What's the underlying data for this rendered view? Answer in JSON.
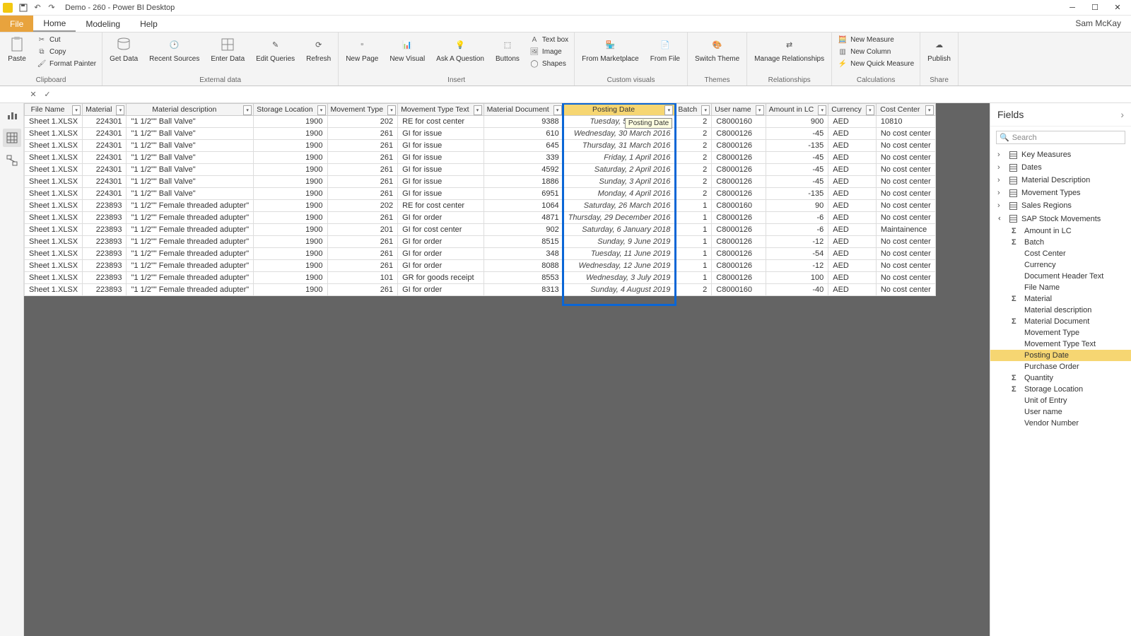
{
  "title": "Demo - 260 - Power BI Desktop",
  "user": "Sam McKay",
  "menu": {
    "file": "File",
    "tabs": [
      "Home",
      "Modeling",
      "Help"
    ],
    "active": "Home"
  },
  "ribbon": {
    "clipboard": {
      "title": "Clipboard",
      "paste": "Paste",
      "cut": "Cut",
      "copy": "Copy",
      "fmt": "Format Painter"
    },
    "external": {
      "title": "External data",
      "get": "Get\nData",
      "recent": "Recent\nSources",
      "enter": "Enter\nData",
      "edit": "Edit\nQueries",
      "refresh": "Refresh"
    },
    "insert": {
      "title": "Insert",
      "page": "New\nPage",
      "visual": "New\nVisual",
      "ask": "Ask A\nQuestion",
      "buttons": "Buttons",
      "text": "Text box",
      "image": "Image",
      "shapes": "Shapes"
    },
    "custom": {
      "title": "Custom visuals",
      "market": "From\nMarketplace",
      "file": "From\nFile"
    },
    "themes": {
      "title": "Themes",
      "switch": "Switch\nTheme"
    },
    "rel": {
      "title": "Relationships",
      "manage": "Manage\nRelationships"
    },
    "calc": {
      "title": "Calculations",
      "nm": "New Measure",
      "nc": "New Column",
      "nq": "New Quick Measure"
    },
    "share": {
      "title": "Share",
      "publish": "Publish"
    }
  },
  "columns": [
    "File Name",
    "Material",
    "Material description",
    "Storage Location",
    "Movement Type",
    "Movement Type Text",
    "Material Document",
    "Posting Date",
    "Batch",
    "User name",
    "Amount in LC",
    "Currency",
    "Cost Center"
  ],
  "highlightCol": 7,
  "tooltip": "Posting Date",
  "rows": [
    [
      "Sheet 1.XLSX",
      "224301",
      "\"1 1/2\"\" Ball Valve\"",
      "1900",
      "202",
      "RE for cost center",
      "9388",
      "Tuesday, 5 March 2016",
      "2",
      "C8000160",
      "900",
      "AED",
      "10810"
    ],
    [
      "Sheet 1.XLSX",
      "224301",
      "\"1 1/2\"\" Ball Valve\"",
      "1900",
      "261",
      "GI for issue",
      "610",
      "Wednesday, 30 March 2016",
      "2",
      "C8000126",
      "-45",
      "AED",
      "No cost center"
    ],
    [
      "Sheet 1.XLSX",
      "224301",
      "\"1 1/2\"\" Ball Valve\"",
      "1900",
      "261",
      "GI for issue",
      "645",
      "Thursday, 31 March 2016",
      "2",
      "C8000126",
      "-135",
      "AED",
      "No cost center"
    ],
    [
      "Sheet 1.XLSX",
      "224301",
      "\"1 1/2\"\" Ball Valve\"",
      "1900",
      "261",
      "GI for issue",
      "339",
      "Friday, 1 April 2016",
      "2",
      "C8000126",
      "-45",
      "AED",
      "No cost center"
    ],
    [
      "Sheet 1.XLSX",
      "224301",
      "\"1 1/2\"\" Ball Valve\"",
      "1900",
      "261",
      "GI for issue",
      "4592",
      "Saturday, 2 April 2016",
      "2",
      "C8000126",
      "-45",
      "AED",
      "No cost center"
    ],
    [
      "Sheet 1.XLSX",
      "224301",
      "\"1 1/2\"\" Ball Valve\"",
      "1900",
      "261",
      "GI for issue",
      "1886",
      "Sunday, 3 April 2016",
      "2",
      "C8000126",
      "-45",
      "AED",
      "No cost center"
    ],
    [
      "Sheet 1.XLSX",
      "224301",
      "\"1 1/2\"\" Ball Valve\"",
      "1900",
      "261",
      "GI for issue",
      "6951",
      "Monday, 4 April 2016",
      "2",
      "C8000126",
      "-135",
      "AED",
      "No cost center"
    ],
    [
      "Sheet 1.XLSX",
      "223893",
      "\"1 1/2\"\" Female threaded adupter\"",
      "1900",
      "202",
      "RE for cost center",
      "1064",
      "Saturday, 26 March 2016",
      "1",
      "C8000160",
      "90",
      "AED",
      "No cost center"
    ],
    [
      "Sheet 1.XLSX",
      "223893",
      "\"1 1/2\"\" Female threaded adupter\"",
      "1900",
      "261",
      "GI for order",
      "4871",
      "Thursday, 29 December 2016",
      "1",
      "C8000126",
      "-6",
      "AED",
      "No cost center"
    ],
    [
      "Sheet 1.XLSX",
      "223893",
      "\"1 1/2\"\" Female threaded adupter\"",
      "1900",
      "201",
      "GI for cost center",
      "902",
      "Saturday, 6 January 2018",
      "1",
      "C8000126",
      "-6",
      "AED",
      "Maintainence"
    ],
    [
      "Sheet 1.XLSX",
      "223893",
      "\"1 1/2\"\" Female threaded adupter\"",
      "1900",
      "261",
      "GI for order",
      "8515",
      "Sunday, 9 June 2019",
      "1",
      "C8000126",
      "-12",
      "AED",
      "No cost center"
    ],
    [
      "Sheet 1.XLSX",
      "223893",
      "\"1 1/2\"\" Female threaded adupter\"",
      "1900",
      "261",
      "GI for order",
      "348",
      "Tuesday, 11 June 2019",
      "1",
      "C8000126",
      "-54",
      "AED",
      "No cost center"
    ],
    [
      "Sheet 1.XLSX",
      "223893",
      "\"1 1/2\"\" Female threaded adupter\"",
      "1900",
      "261",
      "GI for order",
      "8088",
      "Wednesday, 12 June 2019",
      "1",
      "C8000126",
      "-12",
      "AED",
      "No cost center"
    ],
    [
      "Sheet 1.XLSX",
      "223893",
      "\"1 1/2\"\" Female threaded adupter\"",
      "1900",
      "101",
      "GR for goods receipt",
      "8553",
      "Wednesday, 3 July 2019",
      "1",
      "C8000126",
      "100",
      "AED",
      "No cost center"
    ],
    [
      "Sheet 1.XLSX",
      "223893",
      "\"1 1/2\"\" Female threaded adupter\"",
      "1900",
      "261",
      "GI for order",
      "8313",
      "Sunday, 4 August 2019",
      "2",
      "C8000160",
      "-40",
      "AED",
      "No cost center"
    ]
  ],
  "numCols": [
    1,
    3,
    4,
    6,
    8,
    10
  ],
  "dateCol": 7,
  "fields": {
    "title": "Fields",
    "search": "Search",
    "tables": [
      {
        "name": "Key Measures",
        "expanded": false
      },
      {
        "name": "Dates",
        "expanded": false
      },
      {
        "name": "Material Description",
        "expanded": false
      },
      {
        "name": "Movement Types",
        "expanded": false
      },
      {
        "name": "Sales Regions",
        "expanded": false
      },
      {
        "name": "SAP Stock Movements",
        "expanded": true,
        "fields": [
          {
            "n": "Amount in LC",
            "s": true
          },
          {
            "n": "Batch",
            "s": true
          },
          {
            "n": "Cost Center"
          },
          {
            "n": "Currency"
          },
          {
            "n": "Document Header Text"
          },
          {
            "n": "File Name"
          },
          {
            "n": "Material",
            "s": true
          },
          {
            "n": "Material description"
          },
          {
            "n": "Material Document",
            "s": true
          },
          {
            "n": "Movement Type"
          },
          {
            "n": "Movement Type Text"
          },
          {
            "n": "Posting Date",
            "sel": true
          },
          {
            "n": "Purchase Order"
          },
          {
            "n": "Quantity",
            "s": true
          },
          {
            "n": "Storage Location",
            "s": true
          },
          {
            "n": "Unit of Entry"
          },
          {
            "n": "User name"
          },
          {
            "n": "Vendor Number"
          }
        ]
      }
    ]
  }
}
